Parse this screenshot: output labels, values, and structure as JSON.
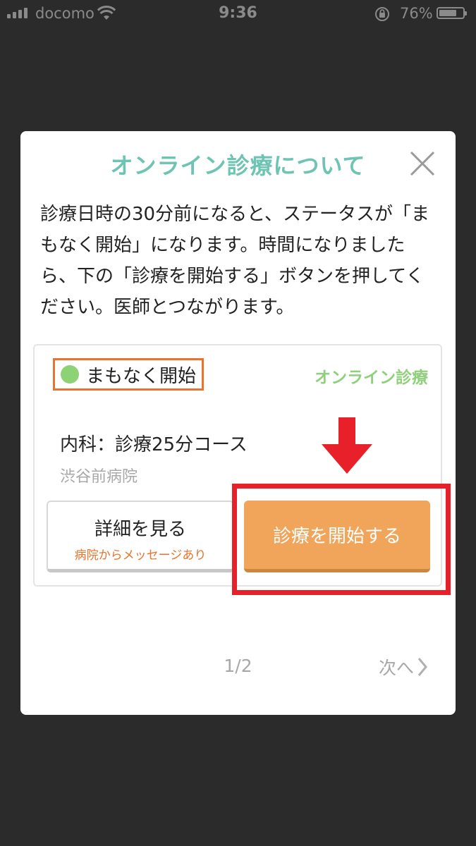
{
  "status_bar": {
    "carrier": "docomo",
    "time": "9:36",
    "battery_percent": "76%",
    "battery_level": 0.76,
    "icons": [
      "signal-icon",
      "wifi-icon",
      "rotation-lock-icon",
      "battery-icon"
    ]
  },
  "modal": {
    "title": "オンライン診療について",
    "description": "診療日時の30分前になると、ステータスが「まもなく開始」になります。時間になりましたら、下の「診療を開始する」ボタンを押してください。医師とつながります。",
    "close_icon": "close-icon"
  },
  "card": {
    "status": "まもなく開始",
    "type": "オンライン診療",
    "course": "内科：診療25分コース",
    "hospital": "渋谷前病院",
    "detail_button": {
      "label": "詳細を見る",
      "sublabel": "病院からメッセージあり"
    },
    "start_button": {
      "label": "診療を開始する"
    }
  },
  "pagination": {
    "indicator": "1/2",
    "next_label": "次へ"
  },
  "colors": {
    "background": "#2b2b2b",
    "title": "#6ec4b3",
    "status_dot": "#8ed276",
    "type_label": "#8fd07a",
    "status_highlight": "#e8732c",
    "start_button": "#f0a55a",
    "annotation_red": "#e8202a"
  }
}
